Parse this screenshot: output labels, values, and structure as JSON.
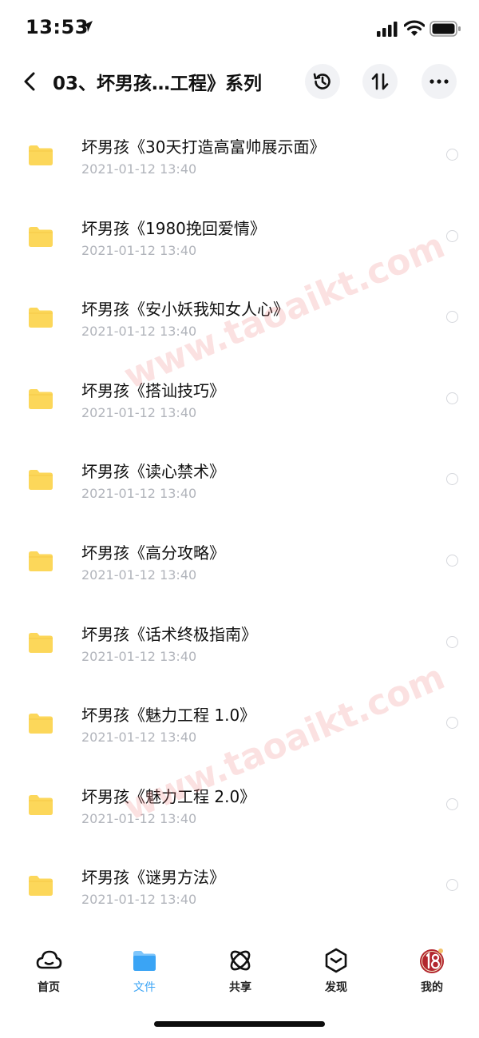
{
  "status_bar": {
    "time": "13:53"
  },
  "header": {
    "title": "03、坏男孩…工程》系列"
  },
  "files": [
    {
      "name": "坏男孩《30天打造高富帅展示面》",
      "date": "2021-01-12 13:40"
    },
    {
      "name": "坏男孩《1980挽回爱情》",
      "date": "2021-01-12 13:40"
    },
    {
      "name": "坏男孩《安小妖我知女人心》",
      "date": "2021-01-12 13:40"
    },
    {
      "name": "坏男孩《搭讪技巧》",
      "date": "2021-01-12 13:40"
    },
    {
      "name": "坏男孩《读心禁术》",
      "date": "2021-01-12 13:40"
    },
    {
      "name": "坏男孩《高分攻略》",
      "date": "2021-01-12 13:40"
    },
    {
      "name": "坏男孩《话术终极指南》",
      "date": "2021-01-12 13:40"
    },
    {
      "name": "坏男孩《魅力工程 1.0》",
      "date": "2021-01-12 13:40"
    },
    {
      "name": "坏男孩《魅力工程 2.0》",
      "date": "2021-01-12 13:40"
    },
    {
      "name": "坏男孩《谜男方法》",
      "date": "2021-01-12 13:40"
    }
  ],
  "watermark": "www.taoaikt.com",
  "tabs": [
    {
      "label": "首页",
      "icon": "cloud-smile-icon",
      "active": false
    },
    {
      "label": "文件",
      "icon": "folder-icon",
      "active": true
    },
    {
      "label": "共享",
      "icon": "atom-share-icon",
      "active": false
    },
    {
      "label": "发现",
      "icon": "cube-discover-icon",
      "active": false
    },
    {
      "label": "我的",
      "icon": "avatar-icon",
      "active": false
    }
  ],
  "colors": {
    "accent": "#3aa4f5",
    "folder": "#fcd75a",
    "date": "#b1b4bb",
    "watermark": "#ee7878"
  }
}
